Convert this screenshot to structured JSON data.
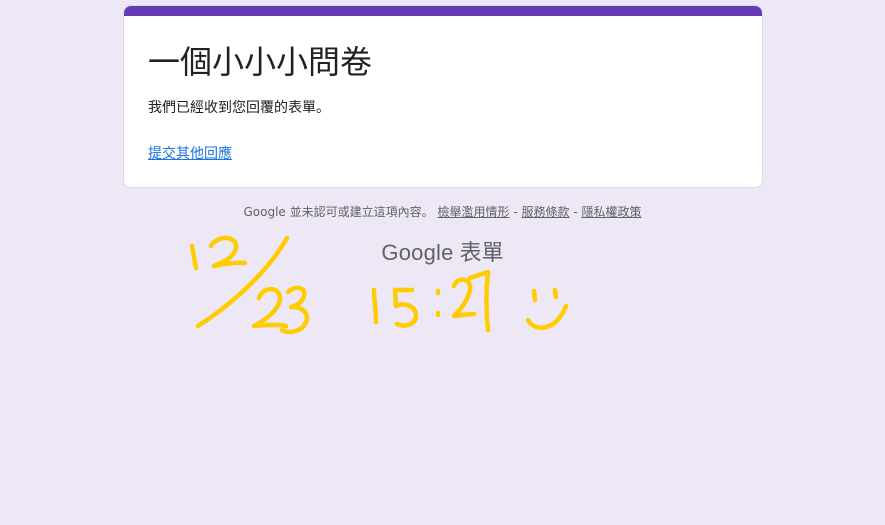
{
  "colors": {
    "page_background": "#ede7f6",
    "accent": "#673ab7",
    "link": "#1a73e8",
    "handwriting": "#ffcc00"
  },
  "form": {
    "title": "一個小小小問卷",
    "confirmation_message": "我們已經收到您回覆的表單。",
    "submit_another_label": "提交其他回應"
  },
  "footer": {
    "disclaimer": "Google 並未認可或建立這項內容。",
    "report_abuse_label": "檢舉濫用情形",
    "separator": "-",
    "terms_label": "服務條款",
    "privacy_label": "隱私權政策"
  },
  "brand": {
    "google": "Google",
    "product": "表單"
  },
  "handwriting": {
    "date": "12/23",
    "time": "15:27",
    "emoticon": "smiley"
  }
}
